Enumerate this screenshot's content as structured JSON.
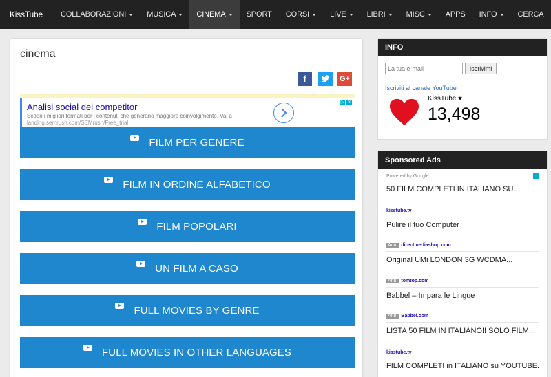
{
  "nav": {
    "brand": "KissTube",
    "items": [
      {
        "label": "COLLABORAZIONI",
        "dropdown": true
      },
      {
        "label": "MUSICA",
        "dropdown": true
      },
      {
        "label": "CINEMA",
        "dropdown": true,
        "active": true
      },
      {
        "label": "SPORT",
        "dropdown": false
      },
      {
        "label": "CORSI",
        "dropdown": true
      },
      {
        "label": "LIVE",
        "dropdown": true
      },
      {
        "label": "LIBRI",
        "dropdown": true
      },
      {
        "label": "MISC",
        "dropdown": true
      },
      {
        "label": "APPS",
        "dropdown": false
      },
      {
        "label": "INFO",
        "dropdown": true
      },
      {
        "label": "CERCA",
        "dropdown": false
      }
    ]
  },
  "main": {
    "title": "cinema",
    "social": {
      "facebook": "f",
      "twitter": "t",
      "googleplus": "G+"
    },
    "ad": {
      "title": "Analisi social dei competitor",
      "desc": "Scopri i migliori formati per i contenuti che generano maggiore coinvolgimento. Vai a",
      "url": "landing.semrush.com/SEMrush/Free_trial"
    },
    "buttons": [
      "FILM PER GENERE",
      "FILM IN ORDINE ALFABETICO",
      "FILM POPOLARI",
      "UN FILM A CASO",
      "FULL MOVIES BY GENRE",
      "FULL MOVIES IN OTHER LANGUAGES"
    ]
  },
  "sidebar": {
    "info": {
      "heading": "INFO",
      "email_placeholder": "La tua e-mail",
      "subscribe_label": "Iscrivimi",
      "yt_link": "Iscriviti al canale YouTube",
      "channel_name": "KissTube",
      "subscribers": "13,498"
    },
    "sponsored": {
      "heading": "Sponsored Ads",
      "powered_by": "Powered by Google",
      "ads": [
        {
          "title": "50 FILM COMPLETI IN ITALIANO SU...",
          "url": "kisstube.tv",
          "annotated": false
        },
        {
          "title": "Pulire il tuo Computer",
          "url": "directmediashop.com",
          "annotated": true
        },
        {
          "title": "Original UMi LONDON 3G WCDMA...",
          "url": "tomtop.com",
          "annotated": true
        },
        {
          "title": "Babbel – Impara le Lingue",
          "url": "Babbel.com",
          "annotated": true
        },
        {
          "title": "LISTA 50 FILM IN ITALIANO!! SOLO FILM...",
          "url": "kisstube.tv",
          "annotated": false
        },
        {
          "title": "FILM COMPLETI in ITALIANO su YOUTUBE...",
          "url": "",
          "annotated": false
        }
      ],
      "ann_label": "Ann."
    }
  },
  "colors": {
    "accent": "#1f87cd",
    "nav_bg": "#222222",
    "heart": "#e0101e"
  }
}
